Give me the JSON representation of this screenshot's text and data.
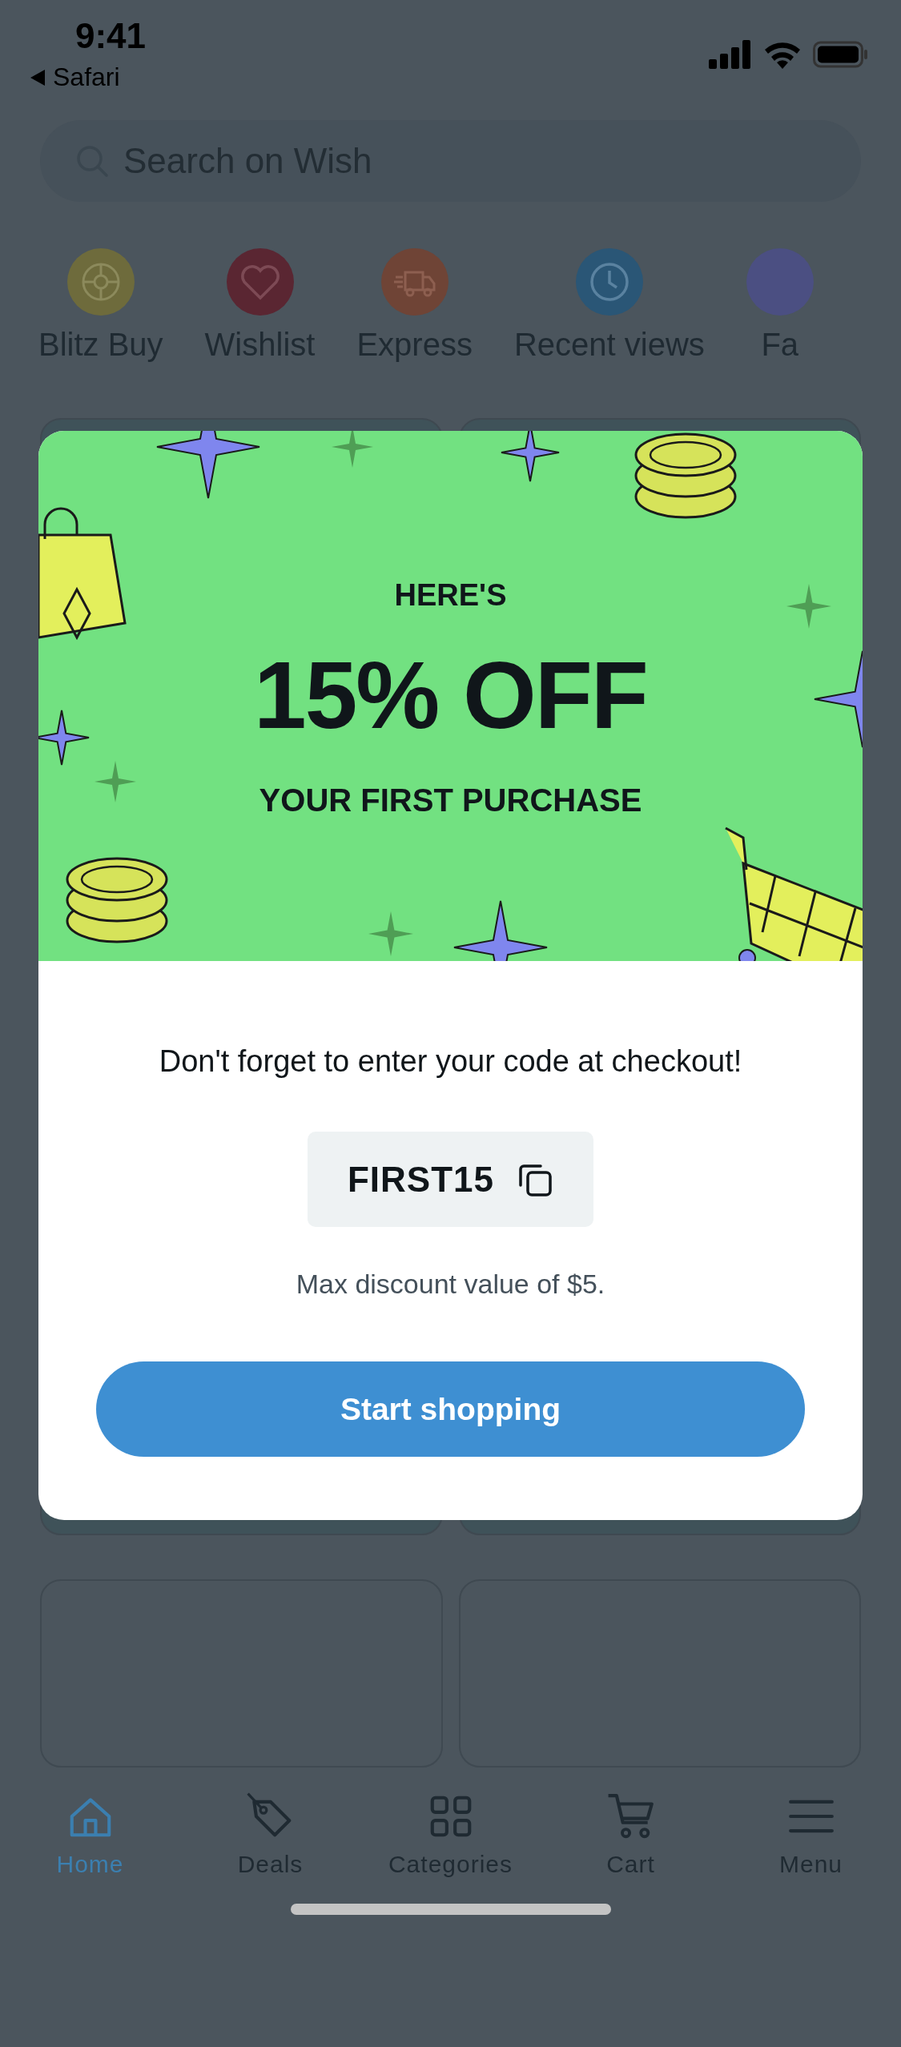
{
  "status_bar": {
    "time": "9:41",
    "back_label": "Safari"
  },
  "search": {
    "placeholder": "Search on Wish"
  },
  "shortcuts": [
    {
      "label": "Blitz Buy",
      "kind": "wheel",
      "color": "#6e6b3c"
    },
    {
      "label": "Wishlist",
      "kind": "heart",
      "color": "#5a2632"
    },
    {
      "label": "Express",
      "kind": "truck",
      "color": "#6f4436"
    },
    {
      "label": "Recent views",
      "kind": "clock",
      "color": "#2a5676"
    },
    {
      "label": "Fa",
      "kind": "blank",
      "color": "#4b4f82"
    }
  ],
  "promo": {
    "eyebrow": "HERE'S",
    "headline": "15% OFF",
    "subline": "YOUR FIRST PURCHASE",
    "message": "Don't forget to enter your code at checkout!",
    "code": "FIRST15",
    "note": "Max discount value of $5.",
    "button": "Start shopping"
  },
  "nav": [
    {
      "label": "Home",
      "kind": "home",
      "selected": true
    },
    {
      "label": "Deals",
      "kind": "tag",
      "selected": false
    },
    {
      "label": "Categories",
      "kind": "grid",
      "selected": false
    },
    {
      "label": "Cart",
      "kind": "cart",
      "selected": false
    },
    {
      "label": "Menu",
      "kind": "menu",
      "selected": false
    }
  ]
}
